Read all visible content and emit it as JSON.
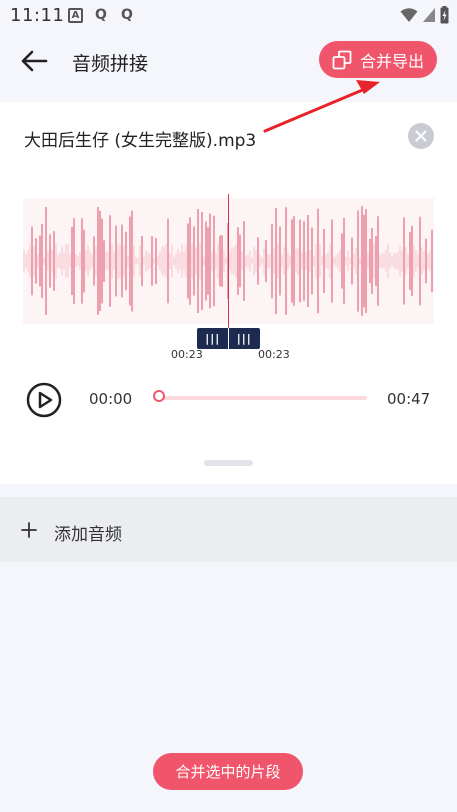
{
  "status_bar": {
    "time": "11:11",
    "notification_icons": [
      "A",
      "Q",
      "Q"
    ]
  },
  "app_bar": {
    "title": "音频拼接",
    "merge_export_label": "合并导出"
  },
  "audio_item": {
    "file_name": "大田后生仔 (女生完整版).mp3",
    "range_start_label": "00:23",
    "range_end_label": "00:23",
    "current_time": "00:00",
    "total_time": "00:47",
    "progress": 0
  },
  "add_audio": {
    "label": "添加音频"
  },
  "bottom": {
    "merge_selected_label": "合并选中的片段"
  },
  "colors": {
    "accent": "#f0556b",
    "waveform": "#e46078",
    "handle": "#1c2b4f",
    "arrow": "#e8232a"
  }
}
